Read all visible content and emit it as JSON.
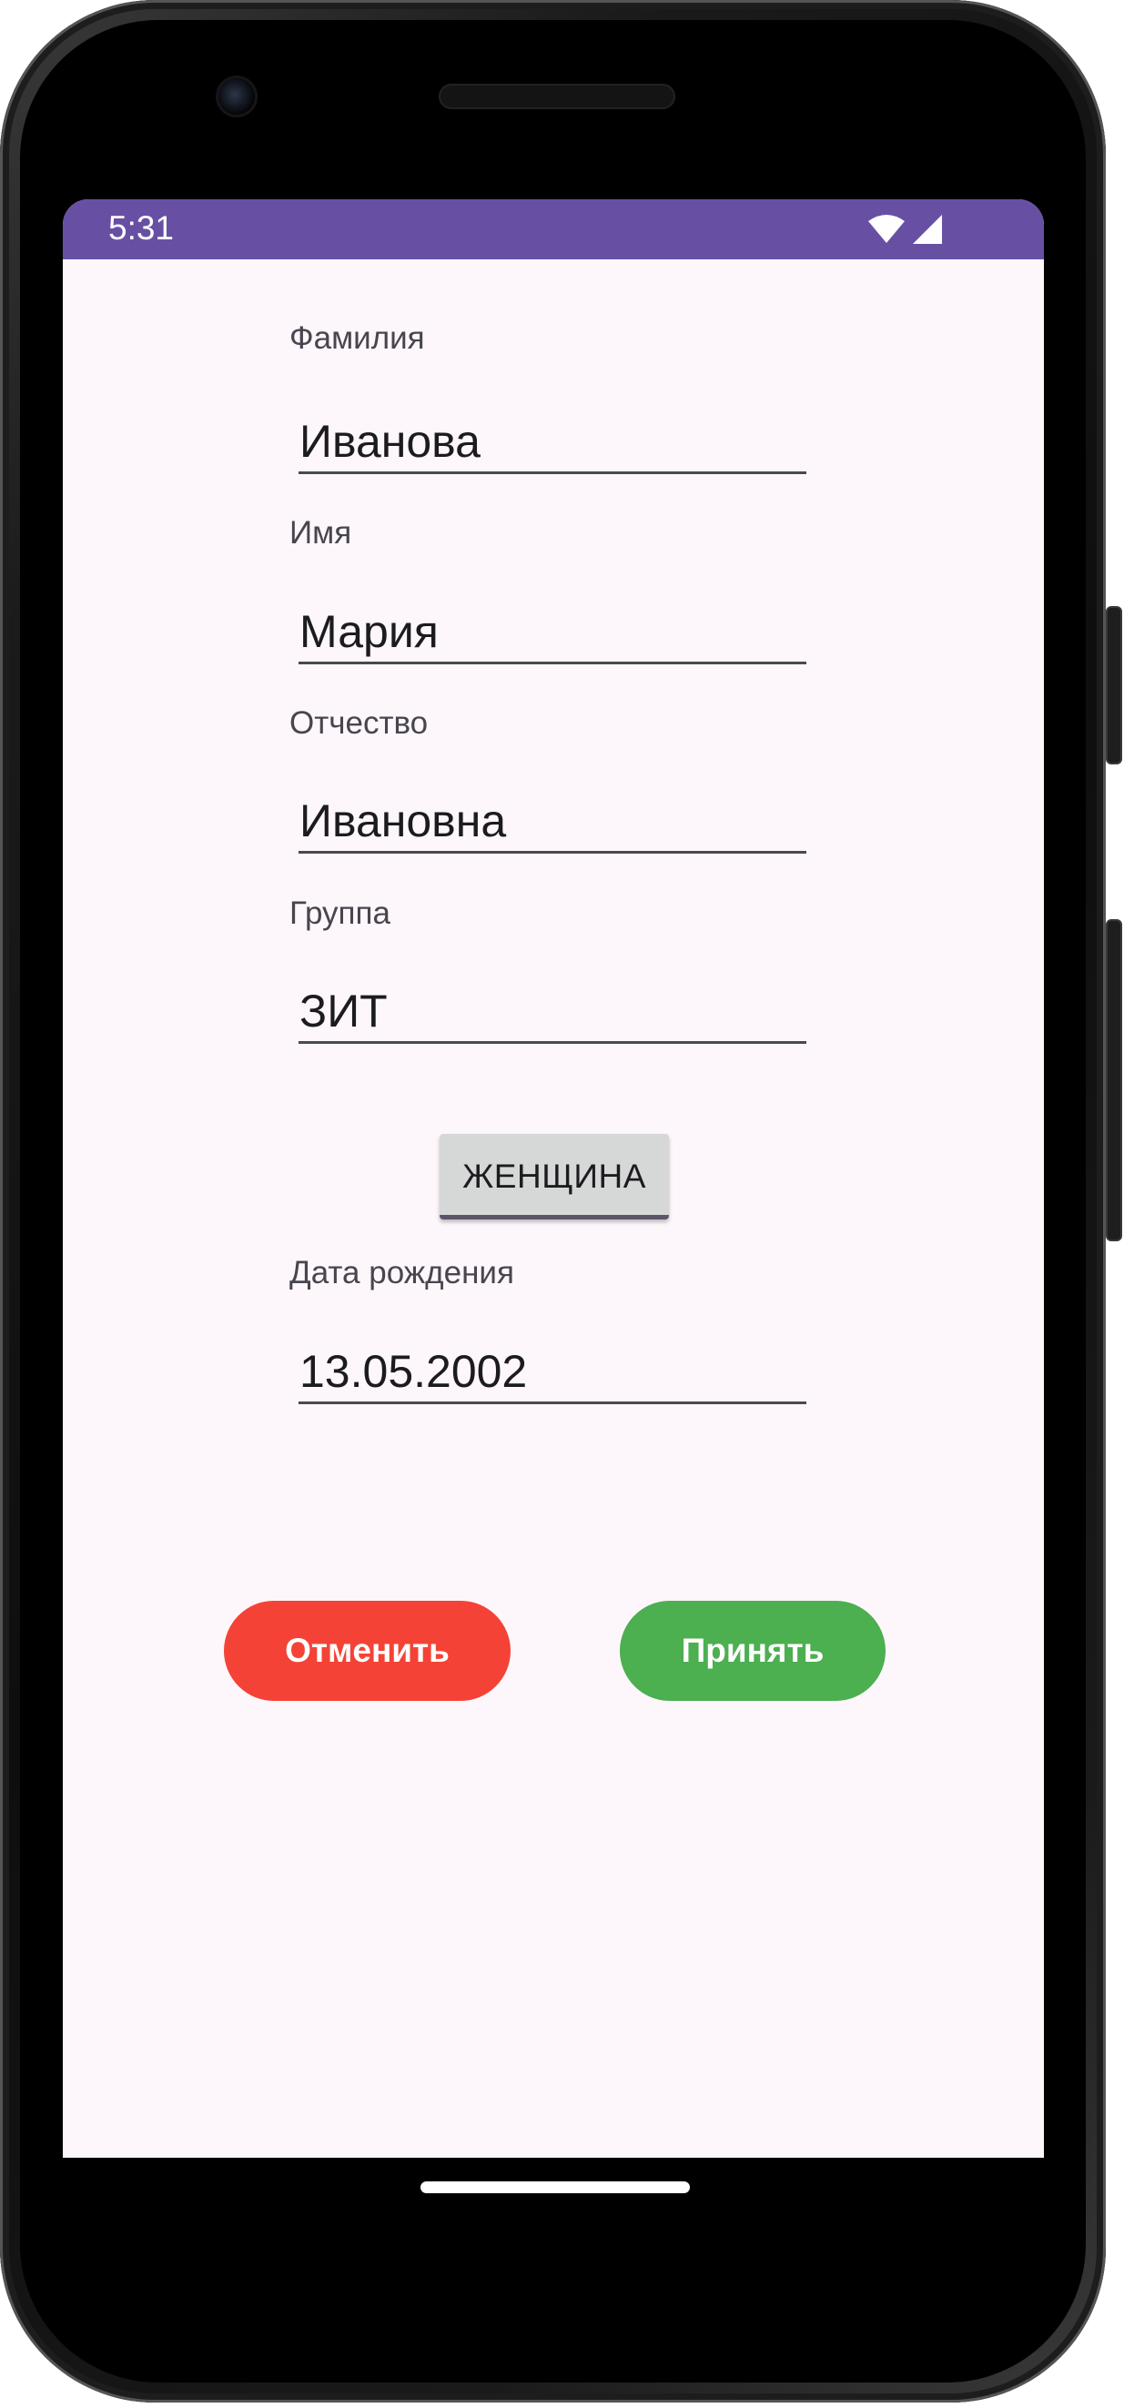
{
  "status_bar": {
    "time": "5:31",
    "background_color": "#6750a4",
    "icons": [
      "wifi-icon",
      "signal-icon"
    ]
  },
  "form": {
    "last_name": {
      "label": "Фамилия",
      "value": "Иванова"
    },
    "first_name": {
      "label": "Имя",
      "value": "Мария"
    },
    "patronymic": {
      "label": "Отчество",
      "value": "Ивановна"
    },
    "group": {
      "label": "Группа",
      "value": "ЗИТ"
    },
    "gender_toggle_label": "ЖЕНЩИНА",
    "birth_date": {
      "label": "Дата рождения",
      "value": "13.05.2002"
    }
  },
  "actions": {
    "cancel_label": "Отменить",
    "cancel_color": "#f44336",
    "accept_label": "Принять",
    "accept_color": "#4caf50"
  }
}
